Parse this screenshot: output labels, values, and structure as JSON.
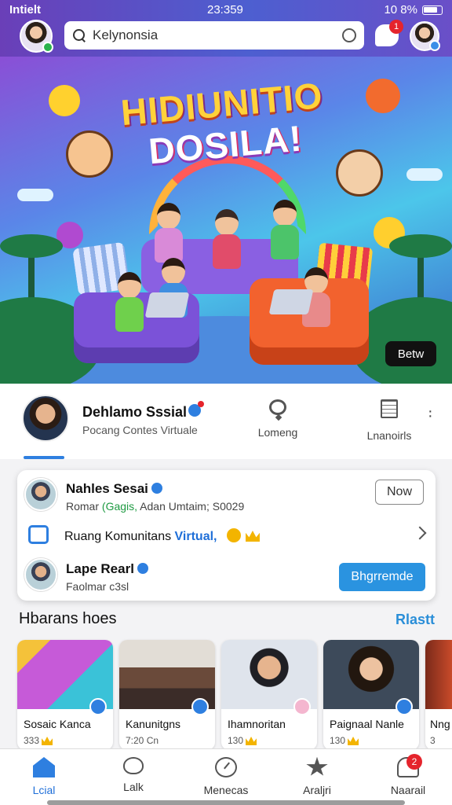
{
  "status_bar": {
    "carrier": "Intielt",
    "time": "23:359",
    "battery": "10 8%"
  },
  "search": {
    "value": "Kelynonsia"
  },
  "chat": {
    "badge": "1"
  },
  "hero": {
    "title_line1": "HIDIUNITIO",
    "title_line2": "DOSILA!",
    "button": "Betw"
  },
  "profile": {
    "name": "Dehlamo Sssial",
    "subtitle": "Pocang Contes Virtuale",
    "tabs": [
      "Lomeng",
      "Lnanoirls"
    ]
  },
  "card": {
    "row1": {
      "title": "Nahles Sesai",
      "meta_prefix": "Romar",
      "meta_green": "(Gagis,",
      "meta_rest": "Adan  Umtaim; S0029",
      "button": "Now"
    },
    "row2": {
      "text": "Ruang Komunitans",
      "highlight": "Virtual,"
    },
    "row3": {
      "title": "Lape Rearl",
      "meta": "Faolmar c3sl",
      "button": "Bhgrremde"
    }
  },
  "section": {
    "title": "Hbarans hoes",
    "link": "Rlastt"
  },
  "tiles": [
    {
      "label": "Sosaic Kanca",
      "stat": "333"
    },
    {
      "label": "Kanunitgns",
      "stat": "7:20 Cn"
    },
    {
      "label": "Ihamnoritan",
      "stat": "130"
    },
    {
      "label": "Paignaal Nanle",
      "stat": "130"
    },
    {
      "label": "Nng",
      "stat": "3"
    }
  ],
  "nav": [
    {
      "label": "Lcial",
      "icon": "home-icon"
    },
    {
      "label": "Lalk",
      "icon": "heart-icon"
    },
    {
      "label": "Menecas",
      "icon": "clock-icon"
    },
    {
      "label": "Araljri",
      "icon": "star-icon"
    },
    {
      "label": "Naarail",
      "icon": "person-icon",
      "badge": "2"
    }
  ],
  "colors": {
    "accent": "#2e7fe0",
    "header_start": "#6a3fb8",
    "header_end": "#4d5fd0",
    "badge": "#e5242c",
    "link": "#2a8ed8"
  }
}
